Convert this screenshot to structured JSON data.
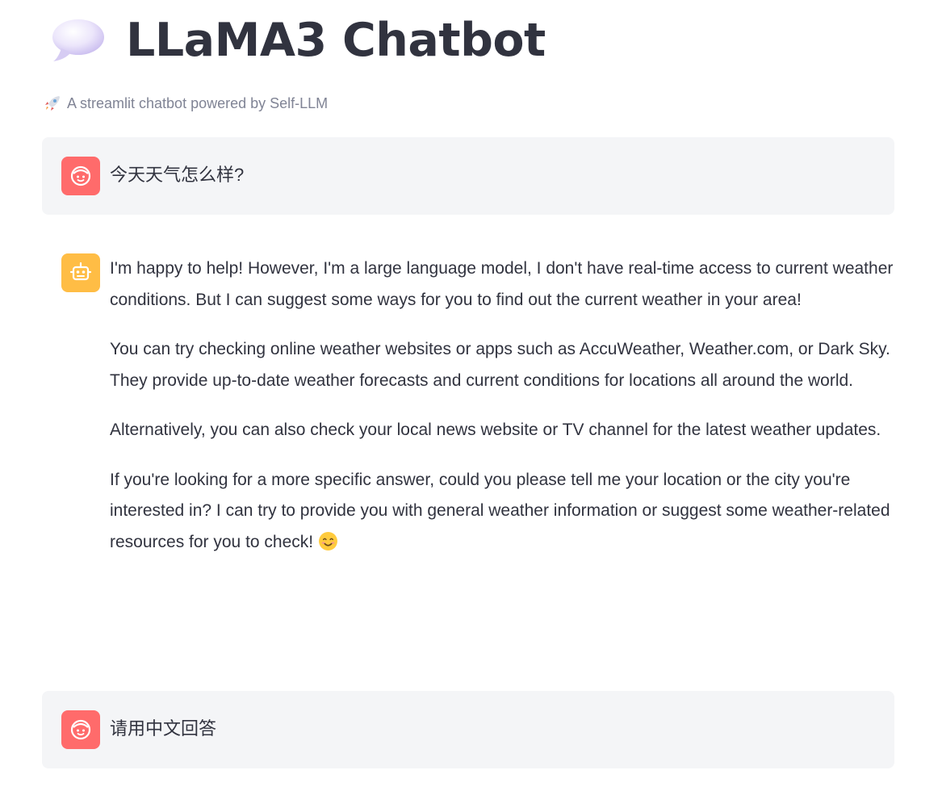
{
  "header": {
    "title": "LLaMA3 Chatbot",
    "title_icon": "speech-balloon-icon",
    "caption": "A streamlit chatbot powered by Self-LLM",
    "caption_icon": "rocket-icon"
  },
  "messages": [
    {
      "role": "user",
      "avatar_icon": "user-face-icon",
      "text": "今天天气怎么样?"
    },
    {
      "role": "assistant",
      "avatar_icon": "robot-face-icon",
      "paragraphs": [
        "I'm happy to help! However, I'm a large language model, I don't have real-time access to current weather conditions. But I can suggest some ways for you to find out the current weather in your area!",
        "You can try checking online weather websites or apps such as AccuWeather, Weather.com, or Dark Sky. They provide up-to-date weather forecasts and current conditions for locations all around the world.",
        "Alternatively, you can also check your local news website or TV channel for the latest weather updates.",
        "If you're looking for a more specific answer, could you please tell me your location or the city you're interested in? I can try to provide you with general weather information or suggest some weather-related resources for you to check!"
      ],
      "trailing_emoji_icon": "smiling-face-icon"
    },
    {
      "role": "user",
      "avatar_icon": "user-face-icon",
      "text": "请用中文回答"
    }
  ],
  "colors": {
    "user_avatar": "#ff6b6b",
    "assistant_avatar": "#ffbd45",
    "user_bubble": "#f4f5f7",
    "text": "#31333f",
    "caption": "#808495"
  }
}
